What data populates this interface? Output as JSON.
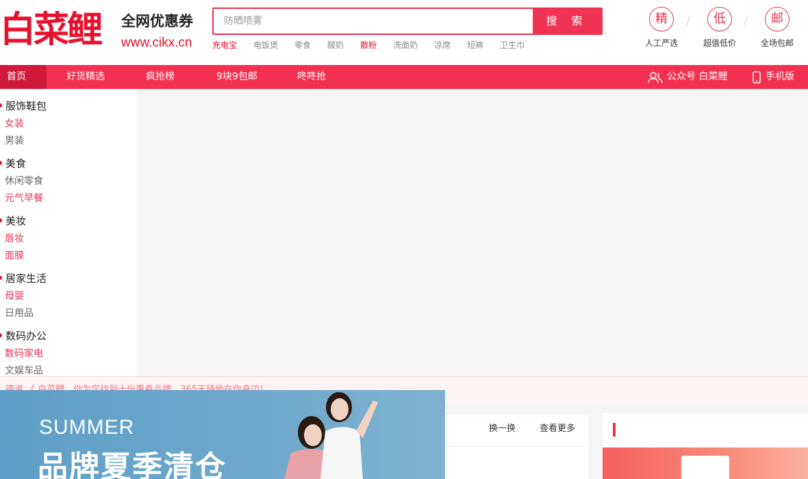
{
  "header": {
    "logo_text": "白菜鲤",
    "slogan": "全网优惠券",
    "site_url": "www.cikx.cn",
    "search": {
      "placeholder": "防晒喷雾",
      "button_label": "搜 索"
    },
    "hot_words": [
      "充电宝",
      "电饭煲",
      "零食",
      "酸奶",
      "散粉",
      "洗面奶",
      "凉席",
      "短裤",
      "卫生巾"
    ],
    "hot_words_highlighted": [
      "充电宝",
      "散粉"
    ],
    "features": [
      {
        "icon": "精",
        "label": "人工严选"
      },
      {
        "icon": "低",
        "label": "超值低价"
      },
      {
        "icon": "邮",
        "label": "全场包邮"
      }
    ]
  },
  "nav": {
    "items": [
      "首页",
      "好货精选",
      "疯抢榜",
      "9块9包邮",
      "咚咚抢"
    ],
    "active": "首页",
    "wechat": "公众号 白菜鲤",
    "mobile": "手机版"
  },
  "sidebar": {
    "categories": [
      {
        "title": "服饰鞋包",
        "subs": [
          "女装",
          "男装"
        ]
      },
      {
        "title": "美食",
        "subs": [
          "休闲零食",
          "元气早餐"
        ]
      },
      {
        "title": "美妆",
        "subs": [
          "唇妆",
          "面膜"
        ]
      },
      {
        "title": "居家生活",
        "subs": [
          "母婴",
          "日用品"
        ]
      },
      {
        "title": "数码办公",
        "subs": [
          "数码家电",
          "文娱车品"
        ]
      }
    ]
  },
  "notice": {
    "text": "德道 《 白菜鲤，你为您找到十份惠券品牌，365天随他在你身边！"
  },
  "banner": {
    "subtitle": "SUMMER",
    "title": "品牌夏季清仓"
  },
  "panel": {
    "refresh_label": "换一换",
    "more_label": "查看更多"
  },
  "colors": {
    "brand": "#e8112d",
    "nav_bg": "#f3304f",
    "search_btn": "#f03352"
  }
}
